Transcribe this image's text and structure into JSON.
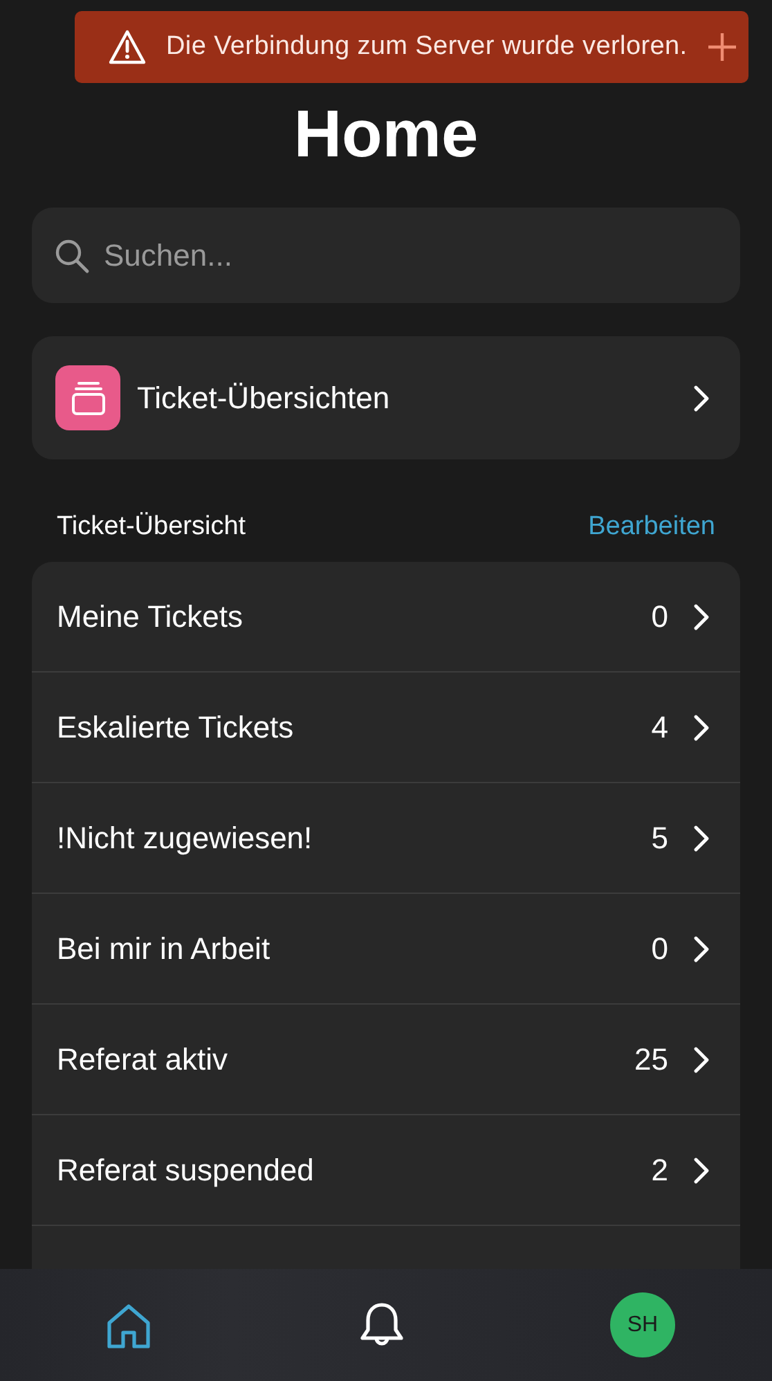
{
  "banner": {
    "message": "Die Verbindung zum Server wurde verloren."
  },
  "title": "Home",
  "search": {
    "placeholder": "Suchen..."
  },
  "shortcut": {
    "label": "Ticket-Übersichten"
  },
  "section": {
    "title": "Ticket-Übersicht",
    "action": "Bearbeiten"
  },
  "overviews": [
    {
      "name": "Meine Tickets",
      "count": "0"
    },
    {
      "name": "Eskalierte Tickets",
      "count": "4"
    },
    {
      "name": "!Nicht zugewiesen!",
      "count": "5"
    },
    {
      "name": "Bei mir in Arbeit",
      "count": "0"
    },
    {
      "name": "Referat aktiv",
      "count": "25"
    },
    {
      "name": "Referat suspended",
      "count": "2"
    }
  ],
  "nav": [
    {
      "kind": "home",
      "selected": true
    },
    {
      "kind": "notifications",
      "selected": false
    },
    {
      "kind": "avatar",
      "initials": "SH",
      "selected": false
    }
  ]
}
